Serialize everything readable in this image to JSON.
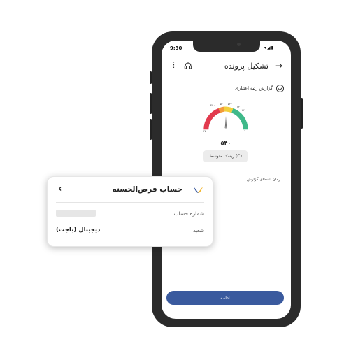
{
  "status_bar": {
    "time": "9:30",
    "icons": "▾◢▮"
  },
  "header": {
    "title": "تشکیل پرونده",
    "back_icon": "arrow-right-icon",
    "menu_icon": "more-vertical-icon",
    "support_icon": "headset-icon"
  },
  "report": {
    "label": "گزارش رتبه اعتباری",
    "icon": "check-circle-icon"
  },
  "gauge": {
    "tick_labels": [
      "۲۵۰",
      "۳۷۰",
      "۵۲۰",
      "۵۴۰",
      "۶۴۰",
      "۷۴۰",
      "۹۰۰"
    ],
    "score": "۵۴۰",
    "risk_label": "ریسک متوسط (C)",
    "colors": {
      "red": "#e23a4e",
      "orange": "#f39b3a",
      "yellow": "#f2cf3b",
      "green": "#3fb98a"
    }
  },
  "expiry": {
    "label": "زمان انقضای گزارش"
  },
  "actions": {
    "continue_label": "ادامه",
    "accent": "#3a5a9e"
  },
  "card": {
    "title": "حساب قرض‌الحسنه",
    "chevron_icon": "chevron-left-icon",
    "logo_icon": "bank-logo-icon",
    "account_label": "شماره حساب",
    "branch_label": "شعبه",
    "branch_value": "دیجیتال (باجت)"
  }
}
